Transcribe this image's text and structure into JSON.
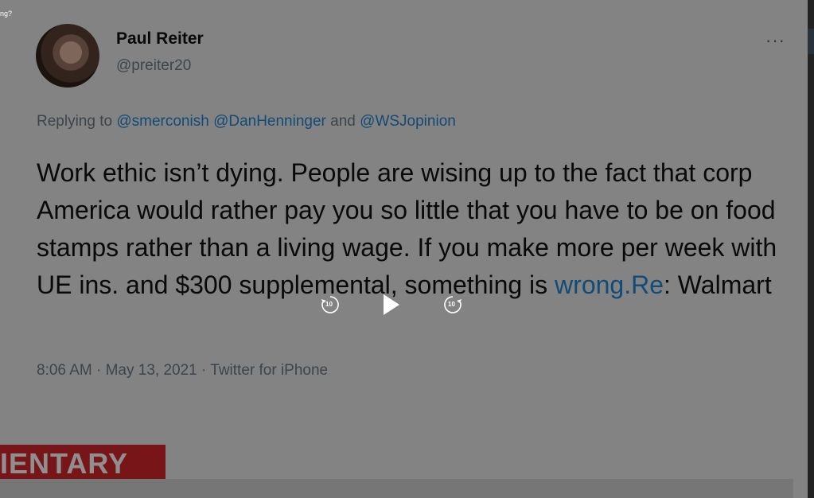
{
  "top_fragment": "ng?",
  "tweet": {
    "display_name": "Paul Reiter",
    "handle": "@preiter20",
    "more": "···",
    "reply_prefix": "Replying to ",
    "mentions": [
      "@smerconish",
      "@DanHenninger"
    ],
    "and": "and",
    "mention_3": "@WSJopinion",
    "body_text": "Work ethic isn’t dying.  People are wising up to the fact that corp America would rather pay you so little that you have to be on food stamps rather than a living wage.  If you make more per week with UE ins. and $300 supplemental, something is ",
    "link_text": "wrong.Re",
    "body_tail": ": Walmart",
    "meta": "8:06 AM · May 13, 2021 · Twitter for iPhone"
  },
  "banner": {
    "text": "IENTARY",
    "color": "#d7272e"
  },
  "controls": {
    "rewind_seconds": "10",
    "forward_seconds": "10"
  }
}
